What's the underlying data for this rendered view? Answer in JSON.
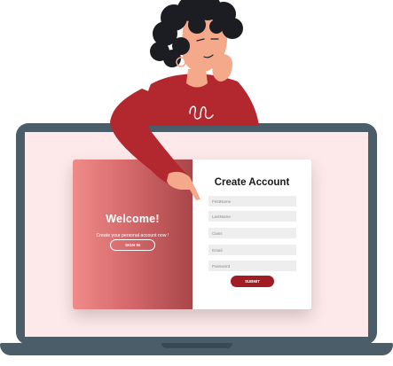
{
  "welcome": {
    "title": "Welcome!",
    "subtitle": "Create your personal account now !",
    "signin_label": "SIGN IN"
  },
  "form": {
    "title": "Create Account",
    "fields": [
      {
        "placeholder": "FirstName"
      },
      {
        "placeholder": "LastName"
      },
      {
        "placeholder": "Class"
      },
      {
        "placeholder": "Email"
      },
      {
        "placeholder": "Password"
      }
    ],
    "submit_label": "SUBMIT"
  },
  "colors": {
    "accent": "#9f1d23",
    "gradient_start": "#f08b88",
    "gradient_end": "#a84649",
    "screen_bg": "#fde9ea",
    "laptop": "#4a5d69",
    "shirt": "#b3282f"
  },
  "illustration": {
    "name": "woman-leaning-on-laptop"
  }
}
